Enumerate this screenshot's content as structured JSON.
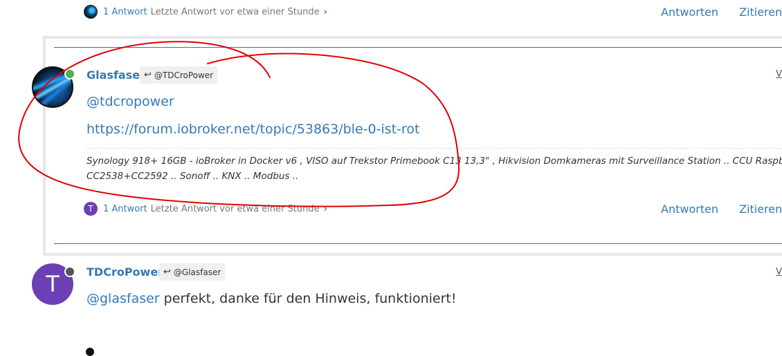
{
  "top_post": {
    "replies_count": "1 Antwort",
    "replies_last": "Letzte Antwort vor etwa einer Stunde",
    "reply_label": "Antworten",
    "quote_label": "Zitieren"
  },
  "post1": {
    "username": "Glasfaser",
    "parent_user": "@TDCroPower",
    "menu_letter": "V",
    "mention": "@tdcropower",
    "link": "https://forum.iobroker.net/topic/53863/ble-0-ist-rot",
    "signature_line1": "Synology 918+ 16GB - ioBroker in Docker v6 , VISO auf Trekstor Primebook C13 13,3\" , Hikvision Domkameras mit Surveillance Station .. CCU RaspberryMatic",
    "signature_line2": "CC2538+CC2592 .. Sonoff .. KNX .. Modbus ..",
    "avatar_letter": "T",
    "replies_count": "1 Antwort",
    "replies_last": "Letzte Antwort vor etwa einer Stunde",
    "reply_label": "Antworten",
    "quote_label": "Zitieren"
  },
  "post2": {
    "username": "TDCroPower",
    "avatar_letter": "T",
    "parent_user": "@Glasfaser",
    "menu_letter": "V",
    "mention": "@glasfaser",
    "text": " perfekt, danke für den Hinweis, funktioniert!"
  },
  "colors": {
    "link": "#337ab7",
    "online": "#4caf50",
    "offline": "#555555",
    "avatar_purple": "#6c3fb5",
    "annotation": "#e00000"
  }
}
